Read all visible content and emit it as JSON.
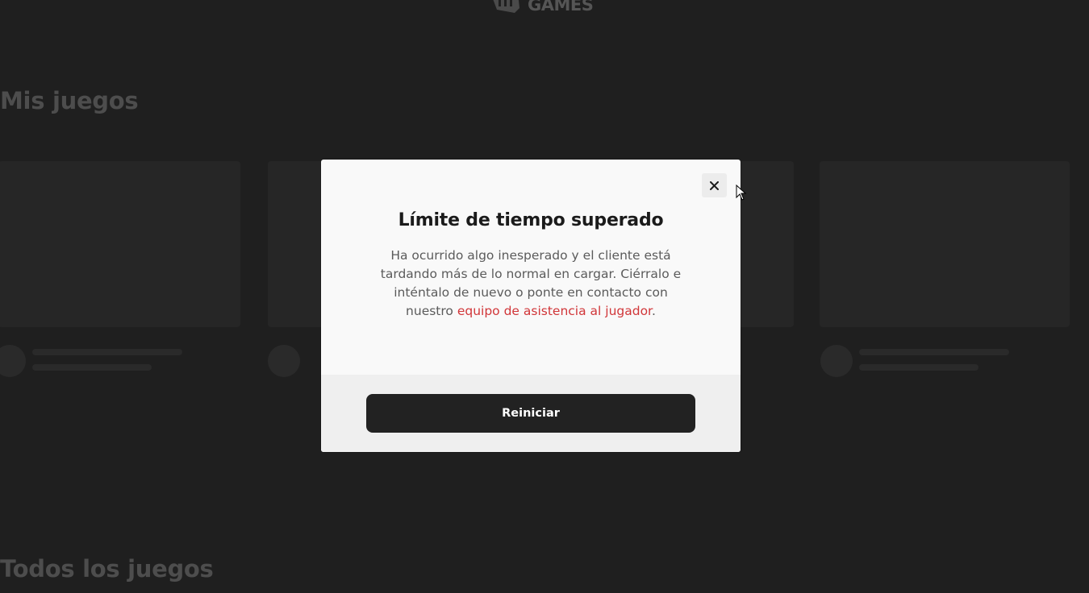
{
  "background": {
    "logo_text": "GAMES",
    "section_my_games": "Mis juegos",
    "section_all_games": "Todos los juegos"
  },
  "dialog": {
    "title": "Límite de tiempo superado",
    "message": "Ha ocurrido algo inesperado y el cliente está tardando más de lo normal en cargar. Ciérralo e inténtalo de nuevo o ponte en contacto con nuestro ",
    "support_link": "equipo de asistencia al jugador",
    "message_end": ".",
    "close_icon": "close-icon",
    "restart_label": "Reiniciar"
  },
  "colors": {
    "backdrop": "#1f1f1f",
    "link": "#d13639",
    "button": "#222222"
  }
}
